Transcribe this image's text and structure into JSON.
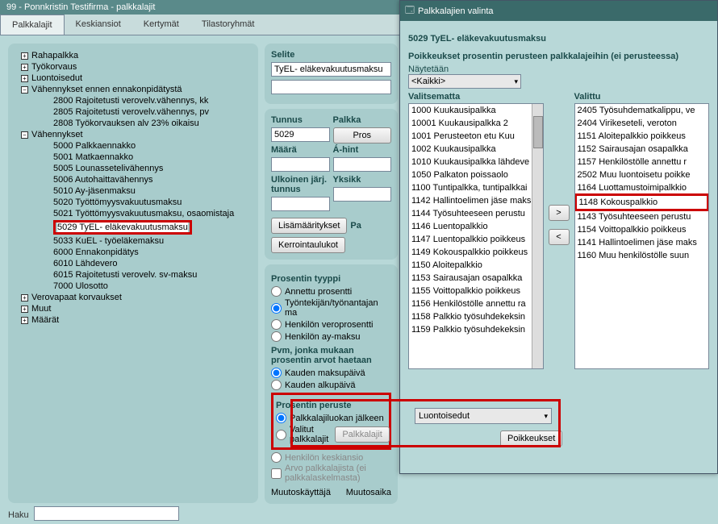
{
  "window": {
    "title": "99 - Ponnkristin Testifirma - palkkalajit"
  },
  "tabs": [
    "Palkkalajit",
    "Keskiansiot",
    "Kertymät",
    "Tilastoryhmät"
  ],
  "tree": {
    "n1": "Rahapalkka",
    "n2": "Työkorvaus",
    "n3": "Luontoisedut",
    "n4": "Vähennykset ennen ennakonpidätystä",
    "n4a": "2800 Rajoitetusti verovelv.vähennys, kk",
    "n4b": "2805 Rajoitetusti verovelv.vähennys, pv",
    "n4c": "2808 Työkorvauksen alv 23% oikaisu",
    "n5": "Vähennykset",
    "n5a": "5000 Palkkaennakko",
    "n5b": "5001 Matkaennakko",
    "n5c": "5005 Lounasseteli­vähennys",
    "n5d": "5006 Autohaitta­vähennys",
    "n5e": "5010 Ay-jäsenmaksu",
    "n5f": "5020 Työttömyysvakuutusmaksu",
    "n5g": "5021 Työttömyysvakuutusmaksu, osaomistaja",
    "n5h": "5029 TyEL- eläkevakuutusmaksu",
    "n5i": "5033 KuEL - työeläkemaksu",
    "n5j": "6000 Ennakonpidätys",
    "n5k": "6010 Lähdevero",
    "n5l": "6015 Rajoitetusti verovelv. sv-maksu",
    "n5m": "7000 Ulosotto",
    "n6": "Verovapaat korvaukset",
    "n7": "Muut",
    "n8": "Määrät"
  },
  "search": {
    "label": "Haku",
    "value": ""
  },
  "form": {
    "selite_label": "Selite",
    "selite_value": "TyEL- eläkevakuutusmaksu",
    "tunnus_label": "Tunnus",
    "tunnus_value": "5029",
    "palkka_label": "Palkka",
    "palkka_btn": "Pros",
    "maara_label": "Määrä",
    "ahint_label": "Á-hint",
    "ulkoinen_label": "Ulkoinen järj. tunnus",
    "yksik_label": "Yksikk",
    "btn_lisa": "Lisämääritykset",
    "btn_kerr": "Kerrointaulukot",
    "pa_label": "Pa",
    "prosentin_tyyppi": "Prosentin tyyppi",
    "pt_opt1": "Annettu prosentti",
    "pt_opt2": "Työntekijän/työnantajan ma",
    "pt_opt3": "Henkilön veroprosentti",
    "pt_opt4": "Henkilön ay-maksu",
    "pvm_label": "Pvm, jonka mukaan prosentin arvot haetaan",
    "pvm_opt1": "Kauden maksupäivä",
    "pvm_opt2": "Kauden alkupäivä",
    "peruste_label": "Prosentin peruste",
    "pp_opt1": "Palkkalajiluokan jälkeen",
    "pp_opt2": "Valitut palkkalajit",
    "pp_combo": "Luontoisedut",
    "btn_palkkalajit": "Palkkalajit",
    "btn_poikkeukset": "Poikkeukset",
    "pp_opt3": "Henkilön keskiansio",
    "arvo_chk": "Arvo palkkalajista (ei palkkalaskelmasta)",
    "muutos1": "Muutoskäyttäjä",
    "muutos2": "Muutosaika"
  },
  "dialog": {
    "title": "Palkkalajien valinta",
    "heading": "5029 TyEL- eläkevakuutusmaksu",
    "poikkeukset": "Poikkeukset prosentin perusteen palkkalajeihin (ei perusteessa)",
    "naytetaan": "Näytetään",
    "kaikki": "<Kaikki>",
    "left_label": "Valitsematta",
    "right_label": "Valittu",
    "left": [
      "1000 Kuukausipalkka",
      "10001 Kuukausipalkka 2",
      "1001 Perusteeton etu Kuu",
      "1002 Kuukausipalkka",
      "1010 Kuukausipalkka lähdeve",
      "1050 Palkaton poissaolo",
      "1100 Tuntipalkka, tuntipalkkai",
      "1142 Hallintoelimen jäse maks",
      "1144 Työsuhteeseen perustu",
      "1146 Luentopalkkio",
      "1147 Luentopalkkio poikkeus",
      "1149 Kokouspalkkio poikkeus",
      "1150 Aloitepalkkio",
      "1153 Sairausajan osapalkka",
      "1155 Voittopalkkio poikkeus",
      "1156 Henkilöstölle annettu ra",
      "1158 Palkkio työsuhdekeksin",
      "1159 Palkkio työsuhdekeksin"
    ],
    "right": [
      "2405 Työsuhdematkalippu, ve",
      "2404 Virikeseteli, veroton",
      "1151 Aloitepalkkio poikkeus",
      "1152 Sairausajan osapalkka",
      "1157 Henkilöstölle annettu r",
      "2502 Muu luontoisetu poikke",
      "1164 Luottamustoimipalkkio",
      "1148 Kokouspalkkio",
      "1143 Työsuhteeseen perustu",
      "1154 Voittopalkkio poikkeus",
      "1141 Hallintoelimen jäse maks",
      "1160 Muu henkilöstölle suun"
    ],
    "move_right": ">",
    "move_left": "<"
  }
}
